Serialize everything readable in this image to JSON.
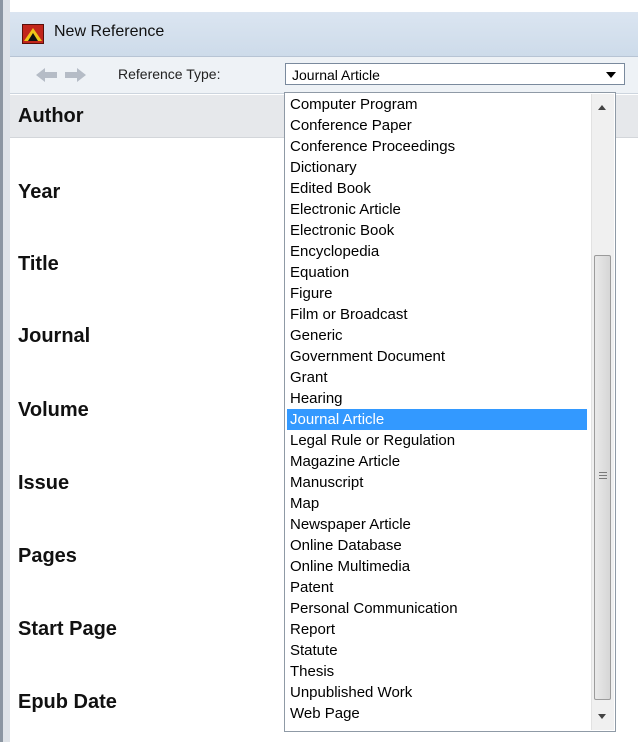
{
  "window": {
    "title": "New Reference",
    "icon": "app-icon"
  },
  "toolbar": {
    "back_icon": "back-arrow-icon",
    "forward_icon": "forward-arrow-icon",
    "reference_type_label": "Reference Type:",
    "selected_type": "Journal Article"
  },
  "fields": [
    "Author",
    "Year",
    "Title",
    "Journal",
    "Volume",
    "Issue",
    "Pages",
    "Start Page",
    "Epub Date"
  ],
  "dropdown": {
    "items": [
      "Computer Program",
      "Conference Paper",
      "Conference Proceedings",
      "Dictionary",
      "Edited Book",
      "Electronic Article",
      "Electronic Book",
      "Encyclopedia",
      "Equation",
      "Figure",
      "Film or Broadcast",
      "Generic",
      "Government Document",
      "Grant",
      "Hearing",
      "Journal Article",
      "Legal Rule or Regulation",
      "Magazine Article",
      "Manuscript",
      "Map",
      "Newspaper Article",
      "Online Database",
      "Online Multimedia",
      "Patent",
      "Personal Communication",
      "Report",
      "Statute",
      "Thesis",
      "Unpublished Work",
      "Web Page"
    ],
    "selected_item": "Journal Article"
  },
  "colors": {
    "selection": "#3399ff",
    "titlebar": "#dbe5f1"
  }
}
